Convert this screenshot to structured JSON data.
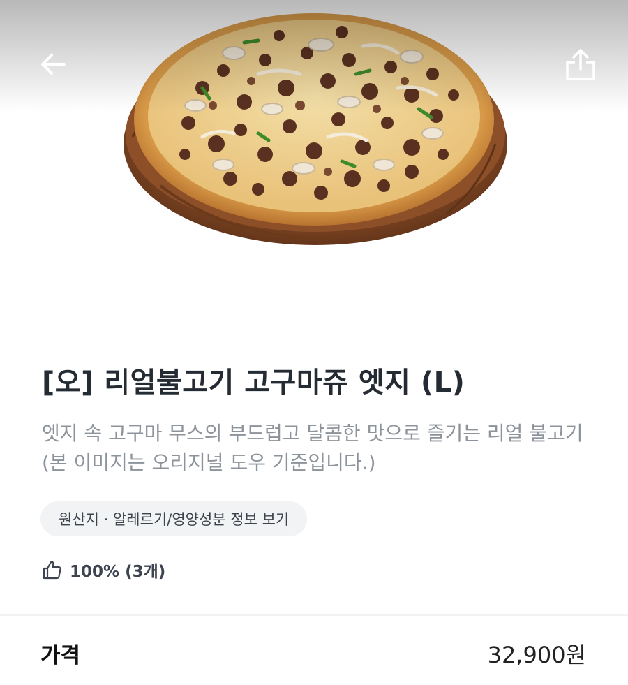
{
  "header": {
    "back_icon": "arrow-left-icon",
    "share_icon": "share-icon"
  },
  "product": {
    "title": "[오] 리얼불고기 고구마쥬 엣지 (L)",
    "description": "엣지 속 고구마 무스의 부드럽고 달콤한 맛으로 즐기는 리얼 불고기(본 이미지는 오리지널 도우 기준입니다.)",
    "info_chip": "원산지 · 알레르기/영양성분 정보 보기",
    "rating_icon": "thumbs-up-icon",
    "rating": "100% (3개)"
  },
  "price": {
    "label": "가격",
    "value": "32,900원"
  }
}
